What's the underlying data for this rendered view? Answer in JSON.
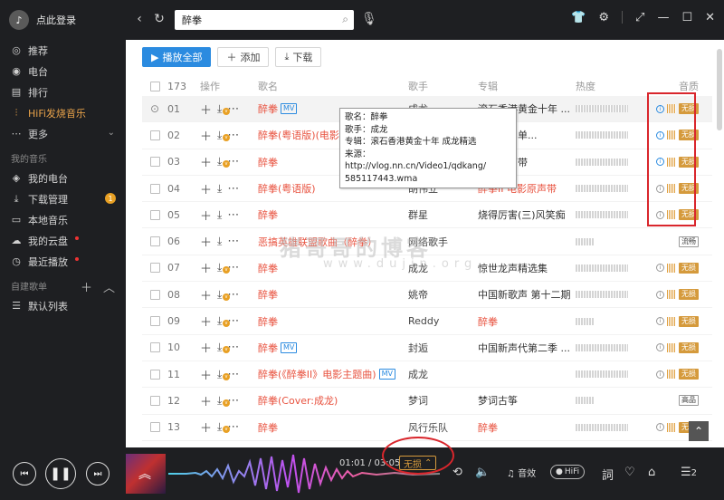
{
  "sidebar": {
    "login_label": "点此登录",
    "nav": [
      {
        "label": "推荐",
        "icon": "recommend-icon",
        "glyph": "◎"
      },
      {
        "label": "电台",
        "icon": "radio-icon",
        "glyph": "◉"
      },
      {
        "label": "排行",
        "icon": "ranking-icon",
        "glyph": "▤"
      },
      {
        "label": "HiFi发烧音乐",
        "icon": "hifi-wave-icon",
        "glyph": "⫶"
      },
      {
        "label": "更多",
        "icon": "more-icon",
        "glyph": "⋯"
      }
    ],
    "my_music_title": "我的音乐",
    "my_music": [
      {
        "label": "我的电台",
        "icon": "my-radio-icon",
        "glyph": "◈"
      },
      {
        "label": "下载管理",
        "icon": "download-manage-icon",
        "glyph": "⤓",
        "badge": "1"
      },
      {
        "label": "本地音乐",
        "icon": "local-music-icon",
        "glyph": "▭"
      },
      {
        "label": "我的云盘",
        "icon": "cloud-disk-icon",
        "glyph": "☁"
      },
      {
        "label": "最近播放",
        "icon": "recent-play-icon",
        "glyph": "◷"
      }
    ],
    "playlist_title": "自建歌单",
    "playlists": [
      {
        "label": "默认列表",
        "icon": "list-icon",
        "glyph": "☰"
      }
    ]
  },
  "topbar": {
    "search_value": "醉拳"
  },
  "toolbar": {
    "play_all": "播放全部",
    "add": "添加",
    "download": "下载"
  },
  "table": {
    "headers": {
      "count": "173",
      "ops": "操作",
      "name": "歌名",
      "artist": "歌手",
      "album": "专辑",
      "heat": "热度",
      "quality": "音质"
    },
    "rows": [
      {
        "num": "01",
        "name": "醉拳",
        "mv": "MV",
        "artist": "成龙",
        "album": "滚石香港黄金十年 ...",
        "quality": "无损"
      },
      {
        "num": "02",
        "name": "醉拳(粤语版)(电影",
        "mv": "",
        "artist": "",
        "album": "酷我热门单...",
        "quality": "无损"
      },
      {
        "num": "03",
        "name": "醉拳",
        "mv": "",
        "artist": "",
        "album": "电影原声带",
        "quality": "无损"
      },
      {
        "num": "04",
        "name": "醉拳(粤语版)",
        "mv": "",
        "artist": "胡伟立",
        "album": "醉拳II 电影原声带",
        "album_hl": "醉拳",
        "quality": "无损"
      },
      {
        "num": "05",
        "name": "醉拳",
        "mv": "",
        "artist": "群星",
        "album": "烧得厉害(三)风笑痴",
        "quality": "无损"
      },
      {
        "num": "06",
        "name": "恶搞英雄联盟歌曲（醉拳）",
        "mv": "",
        "artist": "网络歌手",
        "album": "",
        "quality": "流畅"
      },
      {
        "num": "07",
        "name": "醉拳",
        "mv": "",
        "artist": "成龙",
        "album": "惊世龙声精选集",
        "quality": "无损"
      },
      {
        "num": "08",
        "name": "醉拳",
        "mv": "",
        "artist": "姚帝",
        "album": "中国新歌声 第十二期",
        "quality": "无损"
      },
      {
        "num": "09",
        "name": "醉拳",
        "mv": "",
        "artist": "Reddy",
        "album": "醉拳",
        "album_hl": "醉拳",
        "quality": "无损"
      },
      {
        "num": "10",
        "name": "醉拳",
        "mv": "MV",
        "artist": "封逅",
        "album": "中国新声代第二季 ...",
        "quality": "无损"
      },
      {
        "num": "11",
        "name": "醉拳(《醉拳II》电影主题曲)",
        "mv": "MV",
        "artist": "成龙",
        "album": "",
        "quality": "无损"
      },
      {
        "num": "12",
        "name": "醉拳(Cover:成龙)",
        "mv": "",
        "artist": "梦词",
        "album": "梦词古筝",
        "quality": "高品"
      },
      {
        "num": "13",
        "name": "醉拳",
        "mv": "",
        "artist": "风行乐队",
        "album": "醉拳",
        "album_hl": "醉拳",
        "quality": "无损"
      }
    ]
  },
  "tooltip": {
    "line1": "歌名：醉拳",
    "line2": "歌手：成龙",
    "line3": "专辑：滚石香港黄金十年 成龙精选",
    "line4": "来源：http://vlog.nn.cn/Video1/qdkang/",
    "line5": "585117443.wma"
  },
  "watermark": {
    "cn": "猪哥哥的博客",
    "en": "www.dujin.org"
  },
  "player": {
    "time": "01:01 / 03:05",
    "quality": "无损",
    "sound_effect": "音效",
    "hifi": "HiFi",
    "playlist_count": "2"
  }
}
